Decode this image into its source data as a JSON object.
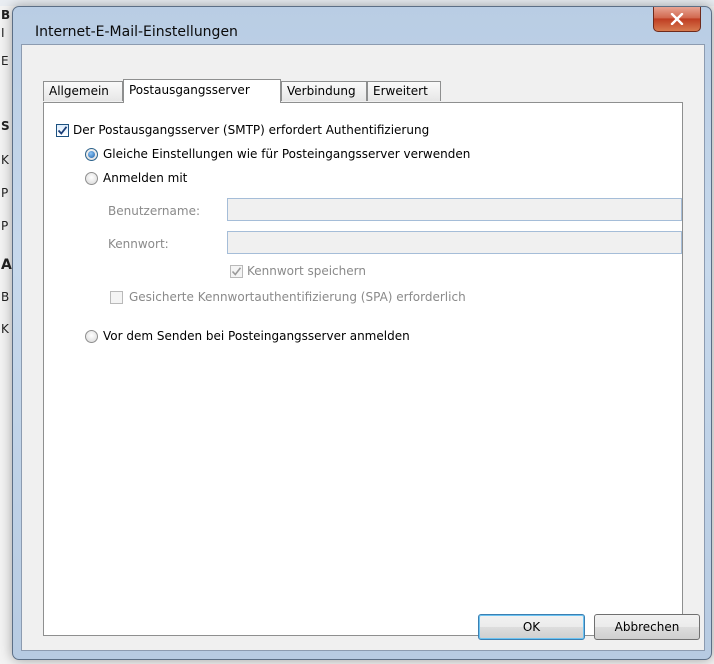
{
  "background": {
    "fragments": [
      "B",
      "I",
      "E",
      "S",
      "K",
      "P",
      "P",
      "A",
      "B",
      "K"
    ]
  },
  "dialog": {
    "title": "Internet-E-Mail-Einstellungen",
    "close_icon": "close-x-icon"
  },
  "tabs": [
    {
      "label": "Allgemein",
      "active": false
    },
    {
      "label": "Postausgangsserver",
      "active": true
    },
    {
      "label": "Verbindung",
      "active": false
    },
    {
      "label": "Erweitert",
      "active": false
    }
  ],
  "panel": {
    "smtp_auth_label": "Der Postausgangsserver (SMTP) erfordert Authentifizierung",
    "smtp_auth_checked": true,
    "radio_same_label": "Gleiche Einstellungen wie für Posteingangsserver verwenden",
    "radio_login_label": "Anmelden mit",
    "username_label": "Benutzername:",
    "username_value": "",
    "password_label": "Kennwort:",
    "password_value": "",
    "save_password_label": "Kennwort speichern",
    "save_password_checked": true,
    "spa_label": "Gesicherte Kennwortauthentifizierung (SPA) erforderlich",
    "spa_checked": false,
    "radio_pop_label": "Vor dem Senden bei Posteingangsserver anmelden",
    "selected_radio": "same"
  },
  "buttons": {
    "ok": "OK",
    "cancel": "Abbrechen"
  }
}
